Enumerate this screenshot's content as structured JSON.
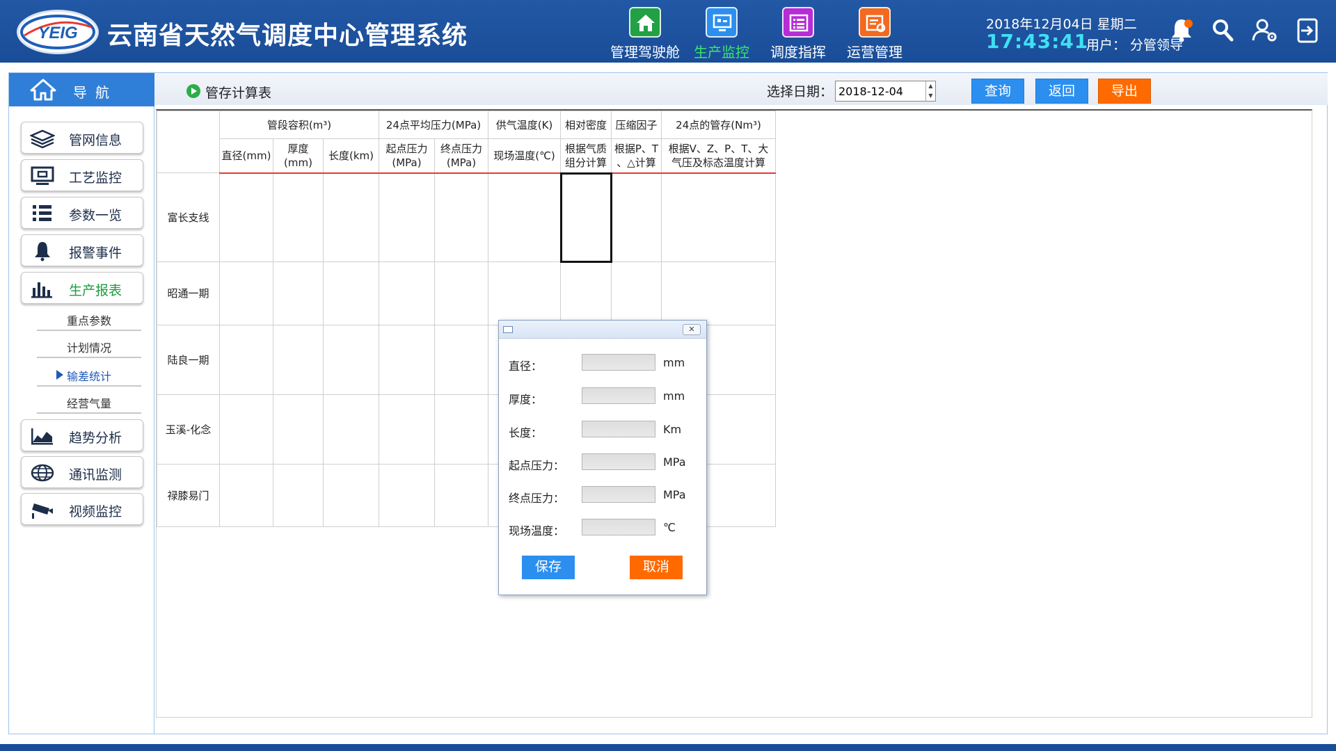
{
  "header": {
    "logo_text": "YEIG",
    "app_title": "云南省天然气调度中心管理系统",
    "nav": [
      {
        "label": "管理驾驶舱",
        "icon": "home-icon",
        "color": "#21a046",
        "active": false
      },
      {
        "label": "生产监控",
        "icon": "monitor-icon",
        "color": "#2c8ff0",
        "active": true
      },
      {
        "label": "调度指挥",
        "icon": "list-icon",
        "color": "#b62cd6",
        "active": false
      },
      {
        "label": "运营管理",
        "icon": "edit-icon",
        "color": "#f26a1f",
        "active": false
      }
    ],
    "date": "2018年12月04日  星期二",
    "time": "17:43:41",
    "user": "用户：  分管领导",
    "icons": [
      "bell-icon",
      "search-icon",
      "user-settings-icon",
      "logout-icon"
    ]
  },
  "sidebar": {
    "nav_title": "导航",
    "items": [
      {
        "label": "管网信息",
        "icon": "layers-icon",
        "active": false
      },
      {
        "label": "工艺监控",
        "icon": "display-icon",
        "active": false
      },
      {
        "label": "参数一览",
        "icon": "bullet-list-icon",
        "active": false
      },
      {
        "label": "报警事件",
        "icon": "bell-icon",
        "active": false
      },
      {
        "label": "生产报表",
        "icon": "bar-chart-icon",
        "active": true
      }
    ],
    "subitems": [
      {
        "label": "重点参数",
        "active": false
      },
      {
        "label": "计划情况",
        "active": false
      },
      {
        "label": "输差统计",
        "active": true
      },
      {
        "label": "经营气量",
        "active": false
      }
    ],
    "items_bottom": [
      {
        "label": "趋势分析",
        "icon": "area-chart-icon"
      },
      {
        "label": "通讯监测",
        "icon": "globe-icon"
      },
      {
        "label": "视频监控",
        "icon": "camera-icon"
      }
    ]
  },
  "toolbar": {
    "page_title": "管存计算表",
    "date_label": "选择日期：",
    "date_value": "2018-12-04",
    "query_label": "查询",
    "back_label": "返回",
    "export_label": "导出"
  },
  "table": {
    "group_headers": [
      "管段容积(m³)",
      "24点平均压力(MPa)",
      "供气温度(K)",
      "相对密度",
      "压缩因子",
      "24点的管存(Nm³)"
    ],
    "sub_headers": [
      "直径(mm)",
      "厚度\n(mm)",
      "长度(km)",
      "起点压力\n(MPa)",
      "终点压力\n(MPa)",
      "现场温度(℃)",
      "根据气质\n组分计算",
      "根据P、T\n、△计算",
      "根据V、Z、P、T、大\n气压及标态温度计算"
    ],
    "rows": [
      "富长支线",
      "昭通一期",
      "陆良一期",
      "玉溪-化念",
      "禄膝易门"
    ]
  },
  "dialog": {
    "close_glyph": "✕",
    "fields": [
      {
        "label": "直径：",
        "value": "",
        "unit": "mm"
      },
      {
        "label": "厚度：",
        "value": "",
        "unit": "mm"
      },
      {
        "label": "长度：",
        "value": "",
        "unit": "Km"
      },
      {
        "label": "起点压力：",
        "value": "",
        "unit": "MPa"
      },
      {
        "label": "终点压力：",
        "value": "",
        "unit": "MPa"
      },
      {
        "label": "现场温度：",
        "value": "",
        "unit": "℃"
      }
    ],
    "save_label": "保存",
    "cancel_label": "取消"
  }
}
